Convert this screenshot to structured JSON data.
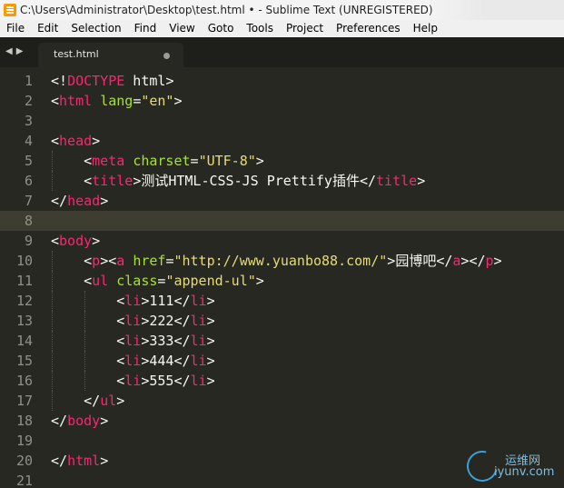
{
  "window": {
    "title": "C:\\Users\\Administrator\\Desktop\\test.html • - Sublime Text (UNREGISTERED)"
  },
  "menu": [
    "File",
    "Edit",
    "Selection",
    "Find",
    "View",
    "Goto",
    "Tools",
    "Project",
    "Preferences",
    "Help"
  ],
  "tabbar": {
    "nav_left": "◀",
    "nav_right": "▶",
    "tab_label": "test.html"
  },
  "editor": {
    "current_line": 8,
    "lines": [
      {
        "n": "1",
        "tokens": [
          [
            "punct",
            "<!"
          ],
          [
            "tag",
            "DOCTYPE"
          ],
          [
            "text",
            " html"
          ],
          [
            "punct",
            ">"
          ]
        ]
      },
      {
        "n": "2",
        "tokens": [
          [
            "punct",
            "<"
          ],
          [
            "tag",
            "html"
          ],
          [
            "text",
            " "
          ],
          [
            "attr",
            "lang"
          ],
          [
            "punct",
            "="
          ],
          [
            "str",
            "\"en\""
          ],
          [
            "punct",
            ">"
          ]
        ]
      },
      {
        "n": "3",
        "tokens": []
      },
      {
        "n": "4",
        "tokens": [
          [
            "punct",
            "<"
          ],
          [
            "tag",
            "head"
          ],
          [
            "punct",
            ">"
          ]
        ]
      },
      {
        "n": "5",
        "tokens": [
          [
            "text",
            "    "
          ],
          [
            "punct",
            "<"
          ],
          [
            "tag",
            "meta"
          ],
          [
            "text",
            " "
          ],
          [
            "attr",
            "charset"
          ],
          [
            "punct",
            "="
          ],
          [
            "str",
            "\"UTF-8\""
          ],
          [
            "punct",
            ">"
          ]
        ]
      },
      {
        "n": "6",
        "tokens": [
          [
            "text",
            "    "
          ],
          [
            "punct",
            "<"
          ],
          [
            "tag",
            "title"
          ],
          [
            "punct",
            ">"
          ],
          [
            "text",
            "测试HTML-CSS-JS Prettify插件"
          ],
          [
            "punct",
            "</"
          ],
          [
            "tag",
            "title"
          ],
          [
            "punct",
            ">"
          ]
        ]
      },
      {
        "n": "7",
        "tokens": [
          [
            "punct",
            "</"
          ],
          [
            "tag",
            "head"
          ],
          [
            "punct",
            ">"
          ]
        ]
      },
      {
        "n": "8",
        "tokens": []
      },
      {
        "n": "9",
        "tokens": [
          [
            "punct",
            "<"
          ],
          [
            "tag",
            "body"
          ],
          [
            "punct",
            ">"
          ]
        ]
      },
      {
        "n": "10",
        "tokens": [
          [
            "text",
            "    "
          ],
          [
            "punct",
            "<"
          ],
          [
            "tag",
            "p"
          ],
          [
            "punct",
            "><"
          ],
          [
            "tag",
            "a"
          ],
          [
            "text",
            " "
          ],
          [
            "attr",
            "href"
          ],
          [
            "punct",
            "="
          ],
          [
            "str",
            "\"http://www.yuanbo88.com/\""
          ],
          [
            "punct",
            ">"
          ],
          [
            "text",
            "园博吧"
          ],
          [
            "punct",
            "</"
          ],
          [
            "tag",
            "a"
          ],
          [
            "punct",
            "></"
          ],
          [
            "tag",
            "p"
          ],
          [
            "punct",
            ">"
          ]
        ]
      },
      {
        "n": "11",
        "tokens": [
          [
            "text",
            "    "
          ],
          [
            "punct",
            "<"
          ],
          [
            "tag",
            "ul"
          ],
          [
            "text",
            " "
          ],
          [
            "attr",
            "class"
          ],
          [
            "punct",
            "="
          ],
          [
            "str",
            "\"append-ul\""
          ],
          [
            "punct",
            ">"
          ]
        ]
      },
      {
        "n": "12",
        "tokens": [
          [
            "text",
            "        "
          ],
          [
            "punct",
            "<"
          ],
          [
            "tag",
            "li"
          ],
          [
            "punct",
            ">"
          ],
          [
            "text",
            "111"
          ],
          [
            "punct",
            "</"
          ],
          [
            "tag",
            "li"
          ],
          [
            "punct",
            ">"
          ]
        ]
      },
      {
        "n": "13",
        "tokens": [
          [
            "text",
            "        "
          ],
          [
            "punct",
            "<"
          ],
          [
            "tag",
            "li"
          ],
          [
            "punct",
            ">"
          ],
          [
            "text",
            "222"
          ],
          [
            "punct",
            "</"
          ],
          [
            "tag",
            "li"
          ],
          [
            "punct",
            ">"
          ]
        ]
      },
      {
        "n": "14",
        "tokens": [
          [
            "text",
            "        "
          ],
          [
            "punct",
            "<"
          ],
          [
            "tag",
            "li"
          ],
          [
            "punct",
            ">"
          ],
          [
            "text",
            "333"
          ],
          [
            "punct",
            "</"
          ],
          [
            "tag",
            "li"
          ],
          [
            "punct",
            ">"
          ]
        ]
      },
      {
        "n": "15",
        "tokens": [
          [
            "text",
            "        "
          ],
          [
            "punct",
            "<"
          ],
          [
            "tag",
            "li"
          ],
          [
            "punct",
            ">"
          ],
          [
            "text",
            "444"
          ],
          [
            "punct",
            "</"
          ],
          [
            "tag",
            "li"
          ],
          [
            "punct",
            ">"
          ]
        ]
      },
      {
        "n": "16",
        "tokens": [
          [
            "text",
            "        "
          ],
          [
            "punct",
            "<"
          ],
          [
            "tag",
            "li"
          ],
          [
            "punct",
            ">"
          ],
          [
            "text",
            "555"
          ],
          [
            "punct",
            "</"
          ],
          [
            "tag",
            "li"
          ],
          [
            "punct",
            ">"
          ]
        ]
      },
      {
        "n": "17",
        "tokens": [
          [
            "text",
            "    "
          ],
          [
            "punct",
            "</"
          ],
          [
            "tag",
            "ul"
          ],
          [
            "punct",
            ">"
          ]
        ]
      },
      {
        "n": "18",
        "tokens": [
          [
            "punct",
            "</"
          ],
          [
            "tag",
            "body"
          ],
          [
            "punct",
            ">"
          ]
        ]
      },
      {
        "n": "19",
        "tokens": []
      },
      {
        "n": "20",
        "tokens": [
          [
            "punct",
            "</"
          ],
          [
            "tag",
            "html"
          ],
          [
            "punct",
            ">"
          ]
        ]
      },
      {
        "n": "21",
        "tokens": []
      }
    ]
  },
  "watermark": {
    "line1": "运维网",
    "line2": "iyunv.com"
  },
  "colors": {
    "editor_bg": "#272822",
    "tag": "#f92672",
    "attr": "#a6e22e",
    "string": "#e6db74",
    "text": "#f8f8f2",
    "line_number": "#8f908a"
  }
}
